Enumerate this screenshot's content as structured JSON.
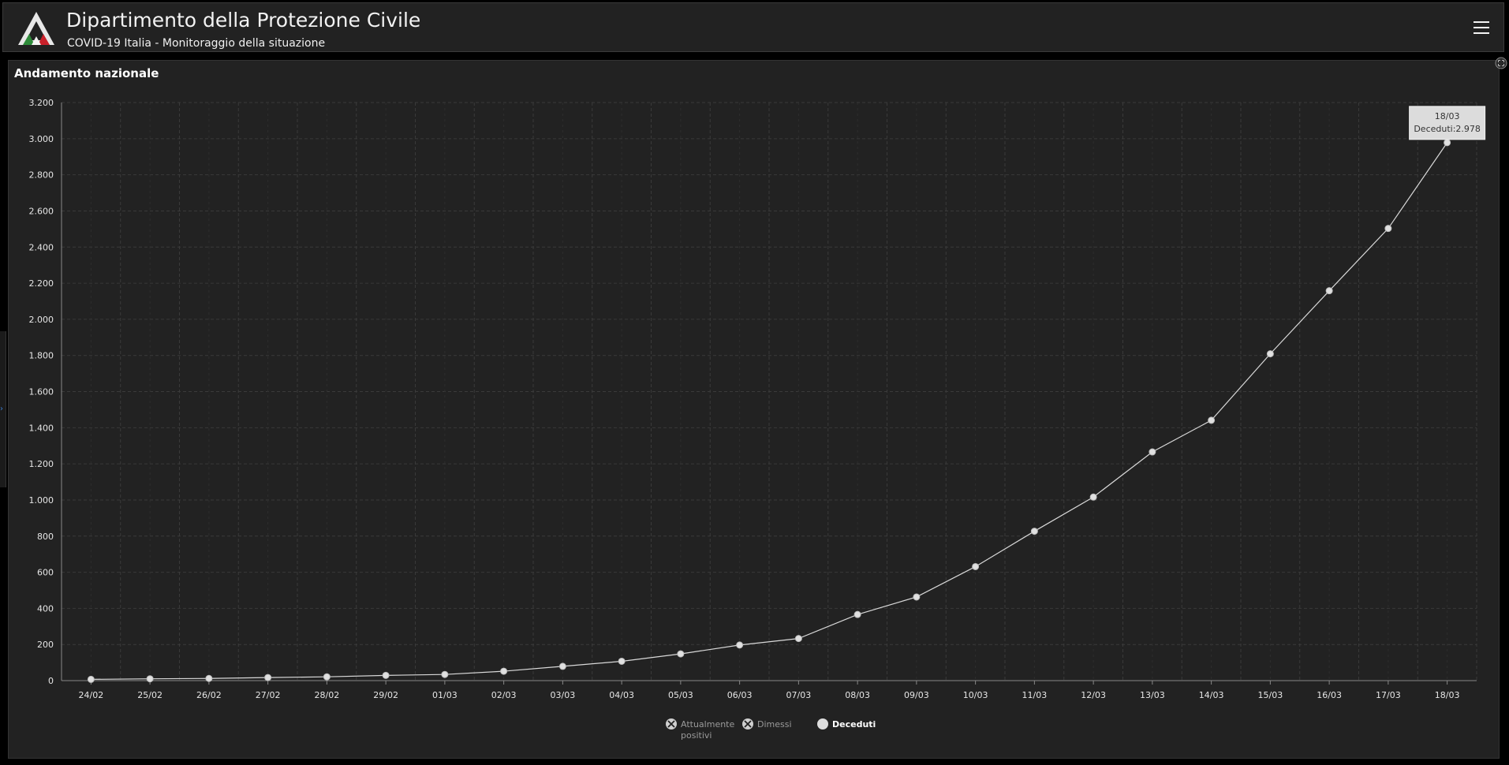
{
  "header": {
    "title": "Dipartimento della Protezione Civile",
    "subtitle": "COVID-19 Italia - Monitoraggio della situazione"
  },
  "panel": {
    "title": "Andamento nazionale"
  },
  "tooltip": {
    "date": "18/03",
    "label": "Deceduti:2.978"
  },
  "legend": [
    {
      "label_lines": [
        "Attualmente",
        "positivi"
      ],
      "state": "disabled"
    },
    {
      "label_lines": [
        "Dimessi"
      ],
      "state": "disabled"
    },
    {
      "label_lines": [
        "Deceduti"
      ],
      "state": "active"
    }
  ],
  "colors": {
    "background": "#000000",
    "panel": "#222222",
    "grid": "#3a3a3a",
    "series": "#d9d9d9",
    "tooltip_bg": "#dcdcdc"
  },
  "chart_data": {
    "type": "line",
    "title": "",
    "xlabel": "",
    "ylabel": "",
    "ylim": [
      0,
      3200
    ],
    "ytick_labels": [
      "0",
      "200",
      "400",
      "600",
      "800",
      "1.000",
      "1.200",
      "1.400",
      "1.600",
      "1.800",
      "2.000",
      "2.200",
      "2.400",
      "2.600",
      "2.800",
      "3.000",
      "3.200"
    ],
    "categories": [
      "24/02",
      "25/02",
      "26/02",
      "27/02",
      "28/02",
      "29/02",
      "01/03",
      "02/03",
      "03/03",
      "04/03",
      "05/03",
      "06/03",
      "07/03",
      "08/03",
      "09/03",
      "10/03",
      "11/03",
      "12/03",
      "13/03",
      "14/03",
      "15/03",
      "16/03",
      "17/03",
      "18/03"
    ],
    "series": [
      {
        "name": "Deceduti",
        "values": [
          7,
          10,
          12,
          17,
          21,
          29,
          34,
          52,
          79,
          107,
          148,
          197,
          233,
          366,
          463,
          631,
          827,
          1016,
          1266,
          1441,
          1809,
          2158,
          2503,
          2978
        ]
      }
    ],
    "grid": true,
    "legend_position": "bottom-center"
  }
}
